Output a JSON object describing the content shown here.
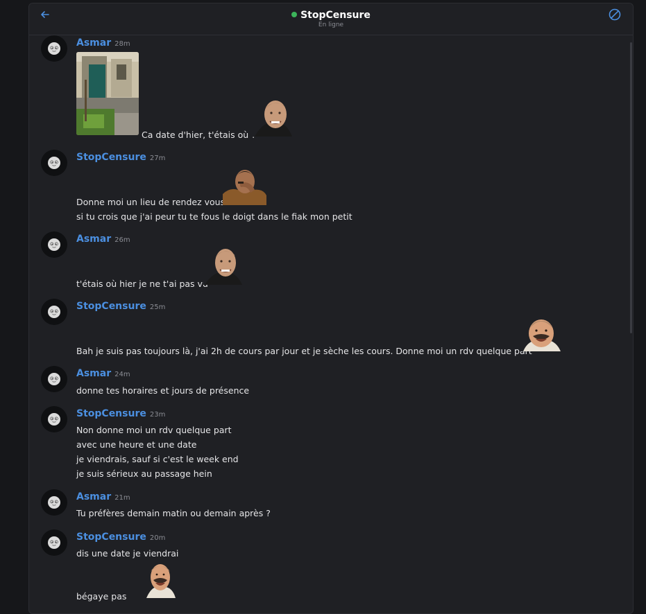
{
  "header": {
    "contact_name": "StopCensure",
    "status": "En ligne",
    "status_color": "#3cb45a",
    "back_icon": "arrow-left-icon",
    "block_icon": "block-icon"
  },
  "colors": {
    "accent": "#4b8fe0",
    "background": "#1f2024"
  },
  "messages": [
    {
      "author": "Asmar",
      "time": "28m",
      "lines": [
        "Ca date d'hier, t'étais où ?"
      ]
    },
    {
      "author": "StopCensure",
      "time": "27m",
      "lines": [
        "Donne moi un lieu de rendez vous",
        "si tu crois que j'ai peur tu te fous le doigt dans le fiak mon petit"
      ]
    },
    {
      "author": "Asmar",
      "time": "26m",
      "lines": [
        "t'étais où hier je ne t'ai pas vu"
      ]
    },
    {
      "author": "StopCensure",
      "time": "25m",
      "lines": [
        "Bah je suis pas toujours là, j'ai 2h de cours par jour et je sèche les cours. Donne moi un rdv quelque part"
      ]
    },
    {
      "author": "Asmar",
      "time": "24m",
      "lines": [
        "donne tes horaires et jours de présence"
      ]
    },
    {
      "author": "StopCensure",
      "time": "23m",
      "lines": [
        "Non donne moi un rdv quelque part",
        "avec une heure et une date",
        "je viendrais, sauf si c'est le week end",
        "je suis sérieux au passage hein"
      ]
    },
    {
      "author": "Asmar",
      "time": "21m",
      "lines": [
        "Tu préfères demain matin ou demain après ?"
      ]
    },
    {
      "author": "StopCensure",
      "time": "20m",
      "lines": [
        "dis une date je viendrai",
        "bégaye pas"
      ]
    }
  ]
}
